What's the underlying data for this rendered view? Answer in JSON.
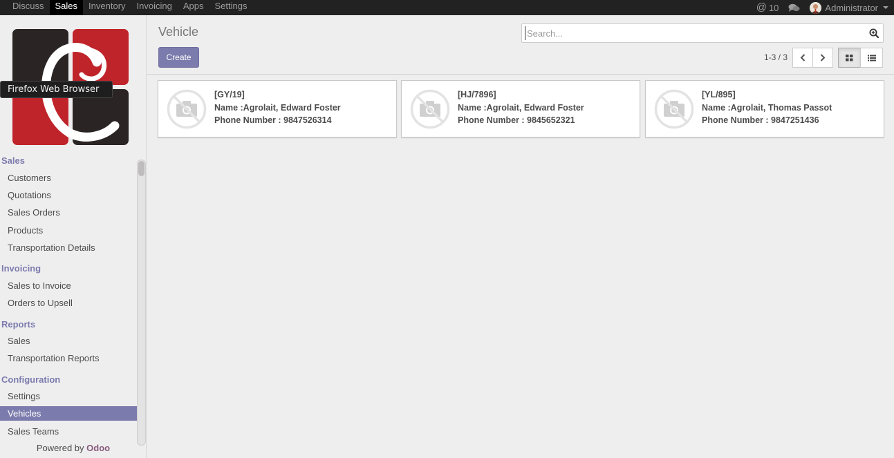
{
  "topbar": {
    "menu": [
      {
        "label": "Discuss",
        "active": false
      },
      {
        "label": "Sales",
        "active": true
      },
      {
        "label": "Inventory",
        "active": false
      },
      {
        "label": "Invoicing",
        "active": false
      },
      {
        "label": "Apps",
        "active": false
      },
      {
        "label": "Settings",
        "active": false
      }
    ],
    "mentions_count": "10",
    "user_name": "Administrator"
  },
  "tooltip": "Firefox Web Browser",
  "sidebar": {
    "sections": [
      {
        "title": "Sales",
        "items": [
          "Customers",
          "Quotations",
          "Sales Orders",
          "Products",
          "Transportation Details"
        ]
      },
      {
        "title": "Invoicing",
        "items": [
          "Sales to Invoice",
          "Orders to Upsell"
        ]
      },
      {
        "title": "Reports",
        "items": [
          "Sales",
          "Transportation Reports"
        ]
      },
      {
        "title": "Configuration",
        "items": [
          "Settings",
          "Vehicles",
          "Sales Teams"
        ]
      }
    ],
    "active_item": "Vehicles",
    "powered_by": "Powered by",
    "powered_brand": "Odoo"
  },
  "control": {
    "title": "Vehicle",
    "create_label": "Create",
    "search_placeholder": "Search...",
    "pager": "1-3 / 3"
  },
  "cards": [
    {
      "ref": "[GY/19]",
      "name": "Name :Agrolait, Edward Foster",
      "phone": "Phone Number : 9847526314"
    },
    {
      "ref": "[HJ/7896]",
      "name": "Name :Agrolait, Edward Foster",
      "phone": "Phone Number : 9845652321"
    },
    {
      "ref": "[YL/895]",
      "name": "Name :Agrolait, Thomas Passot",
      "phone": "Phone Number : 9847251436"
    }
  ],
  "colors": {
    "accent": "#7c7bad",
    "topbar_bg": "#222222",
    "logo_red": "#c0242b",
    "logo_dark": "#2b2424",
    "brand": "#875a7b"
  }
}
